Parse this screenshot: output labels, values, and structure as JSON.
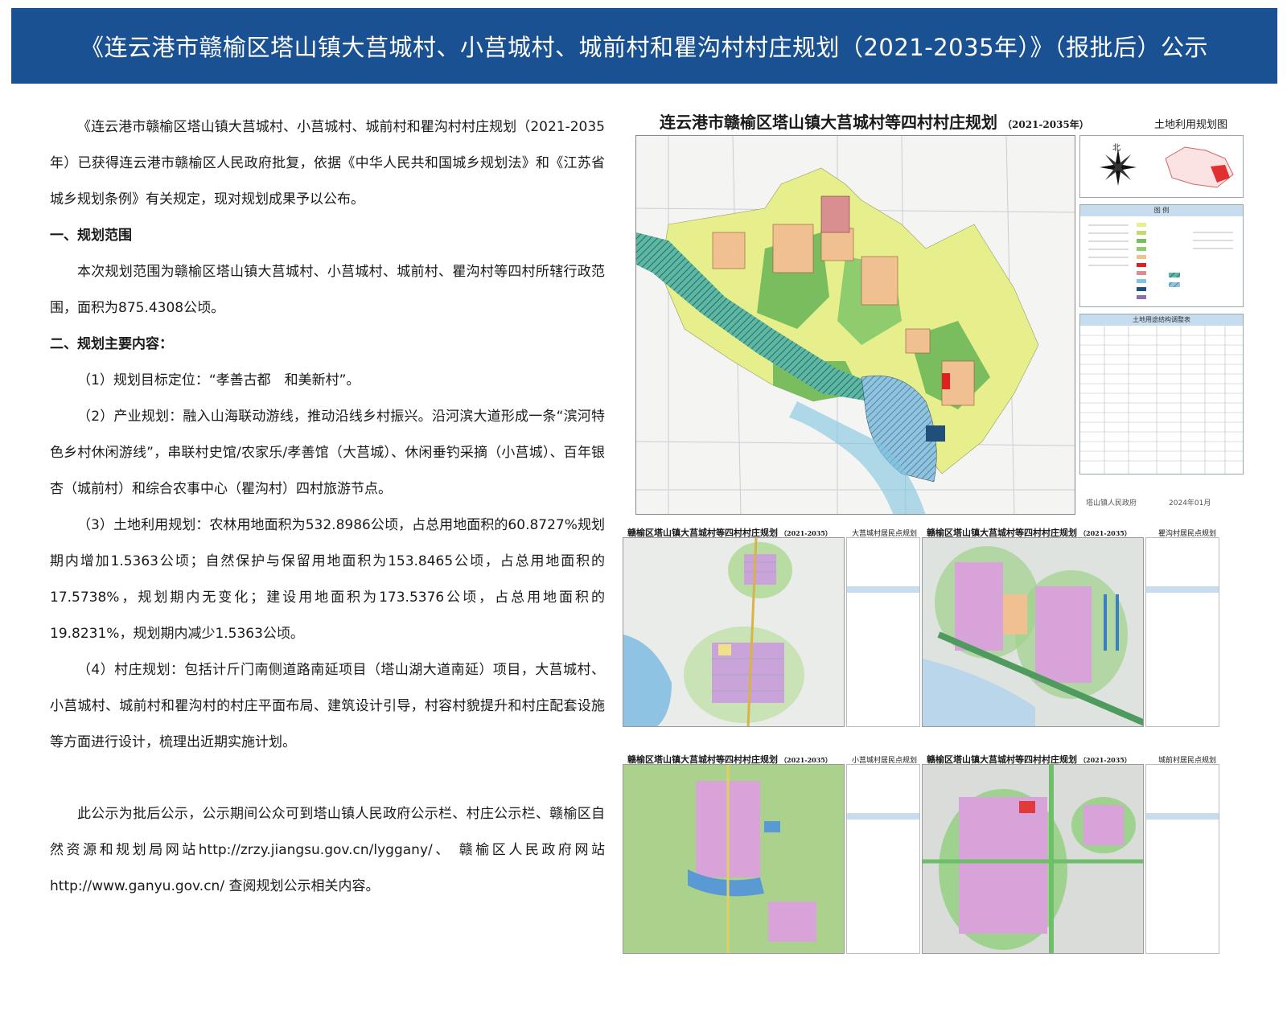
{
  "banner": {
    "title": "《连云港市赣榆区塔山镇大莒城村、小莒城村、城前村和瞿沟村村庄规划（2021-2035年）》（报批后）公示"
  },
  "notice": {
    "intro": "《连云港市赣榆区塔山镇大莒城村、小莒城村、城前村和瞿沟村村庄规划（2021-2035年）已获得连云港市赣榆区人民政府批复，依据《中华人民共和国城乡规划法》和《江苏省城乡规划条例》有关规定，现对规划成果予以公布。",
    "section1_heading": "一、规划范围",
    "section1_body": "本次规划范围为赣榆区塔山镇大莒城村、小莒城村、城前村、瞿沟村等四村所辖行政范围，面积为875.4308公顷。",
    "section2_heading": "二、规划主要内容：",
    "item1": "（1）规划目标定位：“孝善古都　和美新村”。",
    "item2": "（2）产业规划：融入山海联动游线，推动沿线乡村振兴。沿河滨大道形成一条“滨河特色乡村休闲游线”，串联村史馆/农家乐/孝善馆（大莒城）、休闲垂钓采摘（小莒城）、百年银杏（城前村）和综合农事中心（瞿沟村）四村旅游节点。",
    "item3": "（3）土地利用规划：农林用地面积为532.8986公顷，占总用地面积的60.8727%规划期内增加1.5363公顷；自然保护与保留用地面积为153.8465公顷，占总用地面积的17.5738%，规划期内无变化；建设用地面积为173.5376公顷，占总用地面积的19.8231%，规划期内减少1.5363公顷。",
    "item4": "（4）村庄规划：包括计斤门南侧道路南延项目（塔山湖大道南延）项目，大莒城村、小莒城村、城前村和瞿沟村的村庄平面布局、建筑设计引导，村容村貌提升和村庄配套设施等方面进行设计，梳理出近期实施计划。",
    "closing": "此公示为批后公示，公示期间公众可到塔山镇人民政府公示栏、村庄公示栏、赣榆区自然资源和规划局网站http://zrzy.jiangsu.gov.cn/lyggany/、 赣榆区人民政府网站http://www.ganyu.gov.cn/ 查阅规划公示相关内容。"
  },
  "main_map": {
    "title": "连云港市赣榆区塔山镇大莒城村等四村村庄规划",
    "year": "（2021-2035年）",
    "subtitle": "土地利用规划图",
    "north": "北",
    "legend_title": "图 例",
    "table_title": "土地用途结构调整表",
    "issuer": "塔山镇人民政府",
    "date": "2024年01月"
  },
  "sub_maps": [
    {
      "title": "赣榆区塔山镇大莒城村等四村村庄规划",
      "year": "（2021-2035）",
      "subtitle": "大莒城村居民点规划"
    },
    {
      "title": "赣榆区塔山镇大莒城村等四村村庄规划",
      "year": "（2021-2035）",
      "subtitle": "瞿沟村居民点规划"
    },
    {
      "title": "赣榆区塔山镇大莒城村等四村村庄规划",
      "year": "（2021-2035）",
      "subtitle": "小莒城村居民点规划"
    },
    {
      "title": "赣榆区塔山镇大莒城村等四村村庄规划",
      "year": "（2021-2035）",
      "subtitle": "城前村居民点规划"
    }
  ],
  "colors": {
    "banner": "#1a5192",
    "farmland": "#e6ef8c",
    "forest": "#79bd5f",
    "water": "#7fc4e0",
    "village": "#f0c090",
    "hatch": "#3fa58f"
  }
}
